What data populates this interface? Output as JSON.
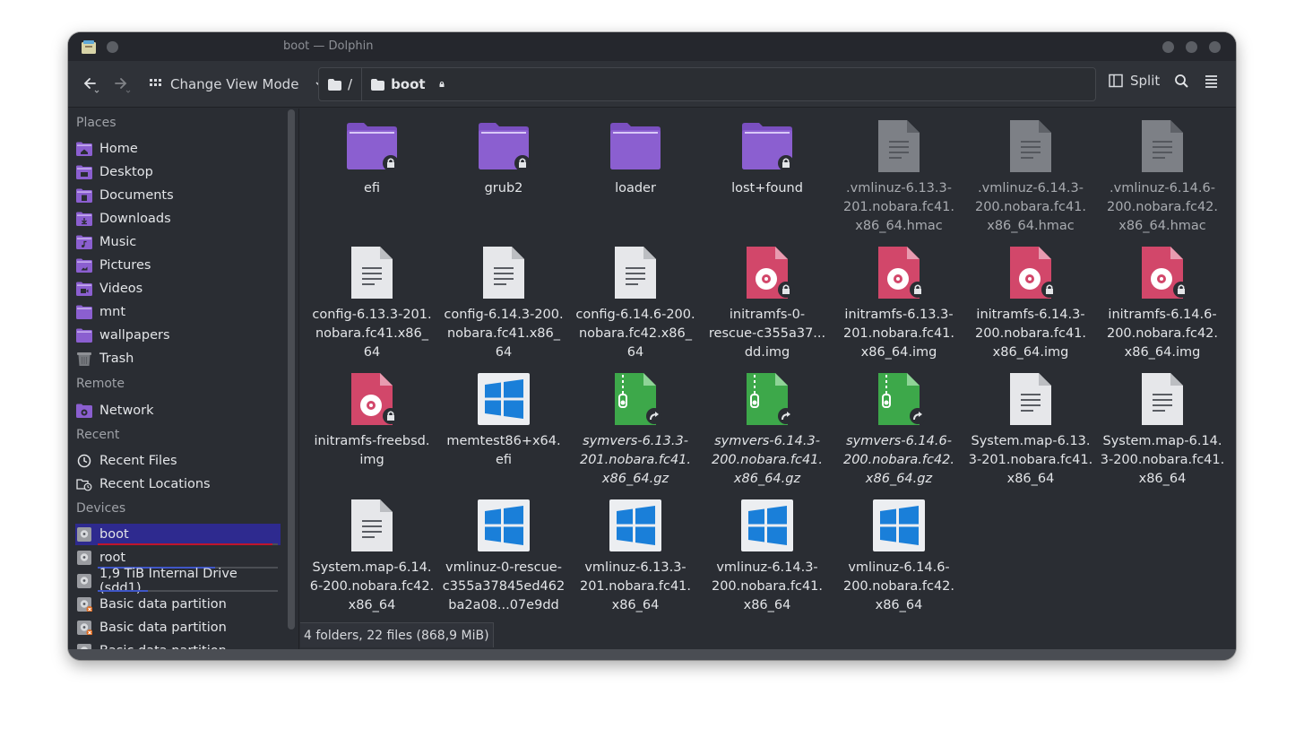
{
  "window": {
    "title": "boot — Dolphin"
  },
  "toolbar": {
    "view_mode_label": "Change View Mode",
    "split_label": "Split"
  },
  "breadcrumb": {
    "root": "/",
    "current": "boot"
  },
  "sidebar": {
    "places_title": "Places",
    "places": [
      "Home",
      "Desktop",
      "Documents",
      "Downloads",
      "Music",
      "Pictures",
      "Videos",
      "mnt",
      "wallpapers",
      "Trash"
    ],
    "remote_title": "Remote",
    "remote": [
      "Network"
    ],
    "recent_title": "Recent",
    "recent": [
      "Recent Files",
      "Recent Locations"
    ],
    "devices_title": "Devices",
    "devices": [
      "boot",
      "root",
      "1,9 TiB Internal Drive (sdd1)",
      "Basic data partition",
      "Basic data partition",
      "Basic data partition"
    ],
    "device_usage": {
      "boot": 0.97,
      "root": 0.65,
      "1,9 TiB Internal Drive (sdd1)": 0.28
    }
  },
  "files": [
    {
      "name": "efi",
      "label_lines": [
        "efi"
      ],
      "kind": "folder",
      "locked": true
    },
    {
      "name": "grub2",
      "label_lines": [
        "grub2"
      ],
      "kind": "folder",
      "locked": true
    },
    {
      "name": "loader",
      "label_lines": [
        "loader"
      ],
      "kind": "folder",
      "locked": false
    },
    {
      "name": "lost+found",
      "label_lines": [
        "lost+found"
      ],
      "kind": "folder",
      "locked": true
    },
    {
      "name": ".vmlinuz-6.13.3-201.nobara.fc41.x86_64.hmac",
      "label_lines": [
        ".vmlinuz-6.13.3-",
        "201.nobara.fc41.",
        "x86_64.hmac"
      ],
      "kind": "hidden-text"
    },
    {
      "name": ".vmlinuz-6.14.3-200.nobara.fc41.x86_64.hmac",
      "label_lines": [
        ".vmlinuz-6.14.3-",
        "200.nobara.fc41.",
        "x86_64.hmac"
      ],
      "kind": "hidden-text"
    },
    {
      "name": ".vmlinuz-6.14.6-200.nobara.fc42.x86_64.hmac",
      "label_lines": [
        ".vmlinuz-6.14.6-",
        "200.nobara.fc42.",
        "x86_64.hmac"
      ],
      "kind": "hidden-text"
    },
    {
      "name": "config-6.13.3-201.nobara.fc41.x86_64",
      "label_lines": [
        "config-6.13.3-201.",
        "nobara.fc41.x86_",
        "64"
      ],
      "kind": "text"
    },
    {
      "name": "config-6.14.3-200.nobara.fc41.x86_64",
      "label_lines": [
        "config-6.14.3-200.",
        "nobara.fc41.x86_",
        "64"
      ],
      "kind": "text"
    },
    {
      "name": "config-6.14.6-200.nobara.fc42.x86_64",
      "label_lines": [
        "config-6.14.6-200.",
        "nobara.fc42.x86_",
        "64"
      ],
      "kind": "text"
    },
    {
      "name": "initramfs-0-rescue-c355a37…dd.img",
      "label_lines": [
        "initramfs-0-",
        "rescue-c355a37...",
        "dd.img"
      ],
      "kind": "disk",
      "locked": true
    },
    {
      "name": "initramfs-6.13.3-201.nobara.fc41.x86_64.img",
      "label_lines": [
        "initramfs-6.13.3-",
        "201.nobara.fc41.",
        "x86_64.img"
      ],
      "kind": "disk",
      "locked": true
    },
    {
      "name": "initramfs-6.14.3-200.nobara.fc41.x86_64.img",
      "label_lines": [
        "initramfs-6.14.3-",
        "200.nobara.fc41.",
        "x86_64.img"
      ],
      "kind": "disk",
      "locked": true
    },
    {
      "name": "initramfs-6.14.6-200.nobara.fc42.x86_64.img",
      "label_lines": [
        "initramfs-6.14.6-",
        "200.nobara.fc42.",
        "x86_64.img"
      ],
      "kind": "disk",
      "locked": true
    },
    {
      "name": "initramfs-freebsd.img",
      "label_lines": [
        "initramfs-freebsd.",
        "img"
      ],
      "kind": "disk",
      "locked": true
    },
    {
      "name": "memtest86+x64.efi",
      "label_lines": [
        "memtest86+x64.",
        "efi"
      ],
      "kind": "windows"
    },
    {
      "name": "symvers-6.13.3-201.nobara.fc41.x86_64.gz",
      "label_lines": [
        "symvers-6.13.3-",
        "201.nobara.fc41.",
        "x86_64.gz"
      ],
      "kind": "archive",
      "italic": true
    },
    {
      "name": "symvers-6.14.3-200.nobara.fc41.x86_64.gz",
      "label_lines": [
        "symvers-6.14.3-",
        "200.nobara.fc41.",
        "x86_64.gz"
      ],
      "kind": "archive",
      "italic": true
    },
    {
      "name": "symvers-6.14.6-200.nobara.fc42.x86_64.gz",
      "label_lines": [
        "symvers-6.14.6-",
        "200.nobara.fc42.",
        "x86_64.gz"
      ],
      "kind": "archive",
      "italic": true
    },
    {
      "name": "System.map-6.13.3-201.nobara.fc41.x86_64",
      "label_lines": [
        "System.map-6.13.",
        "3-201.nobara.fc41.",
        "x86_64"
      ],
      "kind": "text"
    },
    {
      "name": "System.map-6.14.3-200.nobara.fc41.x86_64",
      "label_lines": [
        "System.map-6.14.",
        "3-200.nobara.fc41.",
        "x86_64"
      ],
      "kind": "text"
    },
    {
      "name": "System.map-6.14.6-200.nobara.fc42.x86_64",
      "label_lines": [
        "System.map-6.14.",
        "6-200.nobara.fc42.",
        "x86_64"
      ],
      "kind": "text"
    },
    {
      "name": "vmlinuz-0-rescue-c355a37845ed462ba2a08…07e9dd",
      "label_lines": [
        "vmlinuz-0-rescue-",
        "c355a37845ed462",
        "ba2a08...07e9dd"
      ],
      "kind": "windows"
    },
    {
      "name": "vmlinuz-6.13.3-201.nobara.fc41.x86_64",
      "label_lines": [
        "vmlinuz-6.13.3-",
        "201.nobara.fc41.",
        "x86_64"
      ],
      "kind": "windows"
    },
    {
      "name": "vmlinuz-6.14.3-200.nobara.fc41.x86_64",
      "label_lines": [
        "vmlinuz-6.14.3-",
        "200.nobara.fc41.",
        "x86_64"
      ],
      "kind": "windows"
    },
    {
      "name": "vmlinuz-6.14.6-200.nobara.fc42.x86_64",
      "label_lines": [
        "vmlinuz-6.14.6-",
        "200.nobara.fc42.",
        "x86_64"
      ],
      "kind": "windows"
    }
  ],
  "status": {
    "summary": "4 folders, 22 files (868,9 MiB)"
  },
  "colors": {
    "folder": "#8b5fd0",
    "folder_tab": "#7a4fc0",
    "selected": "#2e2a8f",
    "usage_boot": "#c0152c",
    "usage_other": "#3f56c7",
    "disk": "#d2476a",
    "archive": "#3da84a",
    "windows": "#1a7fd9"
  }
}
